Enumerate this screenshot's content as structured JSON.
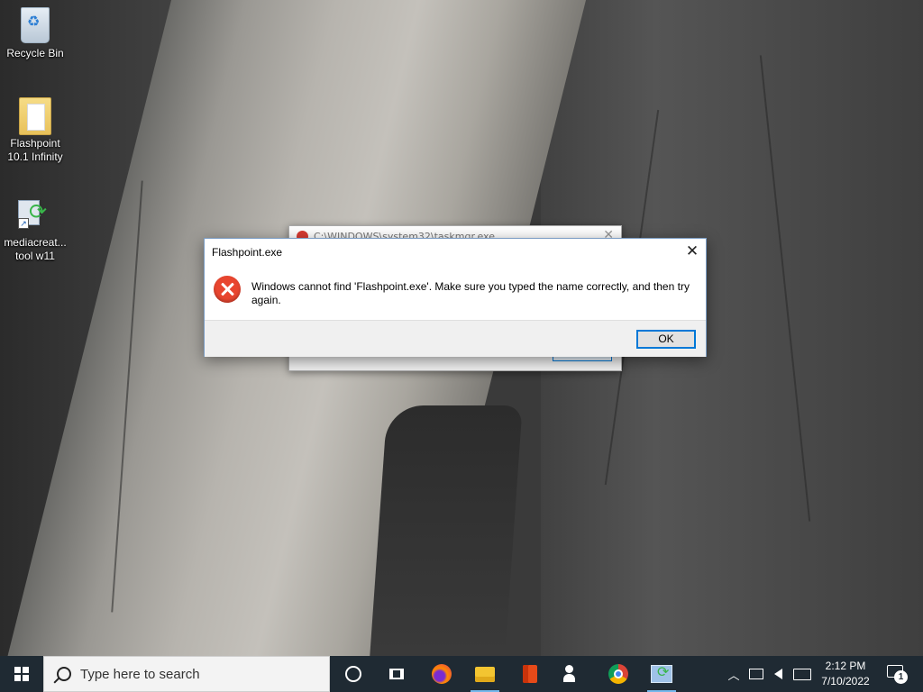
{
  "desktop": {
    "icons": [
      {
        "label": "Recycle Bin",
        "icon": "recycle-bin-icon"
      },
      {
        "label": "Flashpoint 10.1 Infinity",
        "icon": "folder-icon"
      },
      {
        "label": "mediacreat... tool w11",
        "icon": "media-creation-tool-icon"
      }
    ]
  },
  "background_window": {
    "title": "C:\\WINDOWS\\system32\\taskmgr.exe"
  },
  "dialog": {
    "title": "Flashpoint.exe",
    "message": "Windows cannot find 'Flashpoint.exe'. Make sure you typed the name correctly, and then try again.",
    "ok_label": "OK",
    "close_glyph": "✕",
    "icon": "error-icon"
  },
  "taskbar": {
    "search_placeholder": "Type here to search",
    "apps": [
      "cortana-icon",
      "task-view-icon",
      "firefox-icon",
      "file-explorer-icon",
      "office-icon",
      "people-icon",
      "chrome-icon",
      "media-creation-tool-icon"
    ],
    "tray": {
      "chevron": "︿",
      "volume": "🔊",
      "time": "2:12 PM",
      "date": "7/10/2022",
      "notification_count": "1"
    }
  },
  "colors": {
    "taskbar_bg": "#1f2a33",
    "accent": "#0078d7",
    "error_red": "#e8452f"
  }
}
